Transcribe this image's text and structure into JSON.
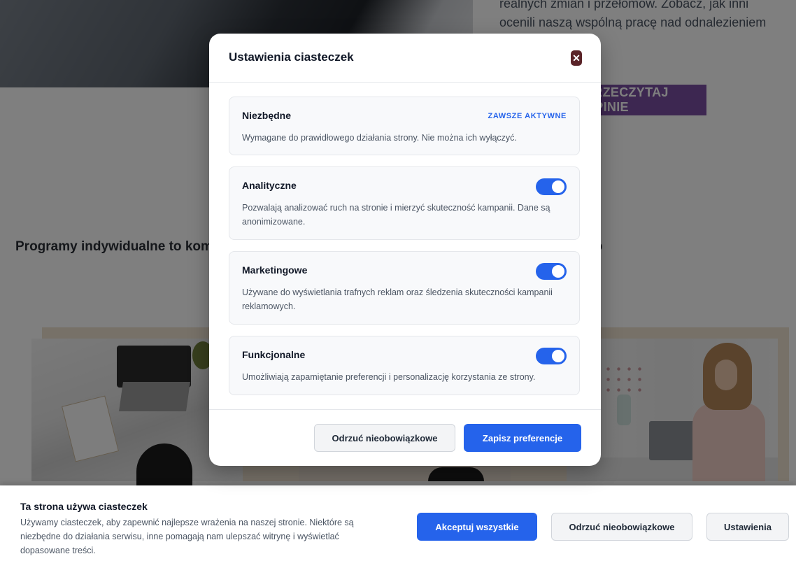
{
  "background": {
    "hero_text": "realnych zmian i przełomów. Zobacz, jak inni ocenili naszą wspólną pracę nad odnalezieniem nowej.",
    "hero_button": "PRZECZYTAJ OPINIE",
    "section_heading": "Programy indywidualne to kompleksowe wsparcie w każdej sytuacji, przez przygotowanie do"
  },
  "modal": {
    "title": "Ustawienia ciasteczek",
    "close_icon": "close-icon",
    "categories": [
      {
        "title": "Niezbędne",
        "badge": "ZAWSZE AKTYWNE",
        "description": "Wymagane do prawidłowego działania strony. Nie można ich wyłączyć."
      },
      {
        "title": "Analityczne",
        "enabled": true,
        "description": "Pozwalają analizować ruch na stronie i mierzyć skuteczność kampanii. Dane są anonimizowane."
      },
      {
        "title": "Marketingowe",
        "enabled": true,
        "description": "Używane do wyświetlania trafnych reklam oraz śledzenia skuteczności kampanii reklamowych."
      },
      {
        "title": "Funkcjonalne",
        "enabled": true,
        "description": "Umożliwiają zapamiętanie preferencji i personalizację korzystania ze strony."
      }
    ],
    "reject_label": "Odrzuć nieobowiązkowe",
    "save_label": "Zapisz preferencje"
  },
  "banner": {
    "title": "Ta strona używa ciasteczek",
    "description": "Używamy ciasteczek, aby zapewnić najlepsze wrażenia na naszej stronie. Niektóre są niezbędne do działania serwisu, inne pomagają nam ulepszać witrynę i wyświetlać dopasowane treści.",
    "accept_label": "Akceptuj wszystkie",
    "reject_label": "Odrzuć nieobowiązkowe",
    "settings_label": "Ustawienia"
  },
  "colors": {
    "accent": "#2563eb",
    "hero_button": "#7a4fa3",
    "close_button": "#5a2328"
  }
}
